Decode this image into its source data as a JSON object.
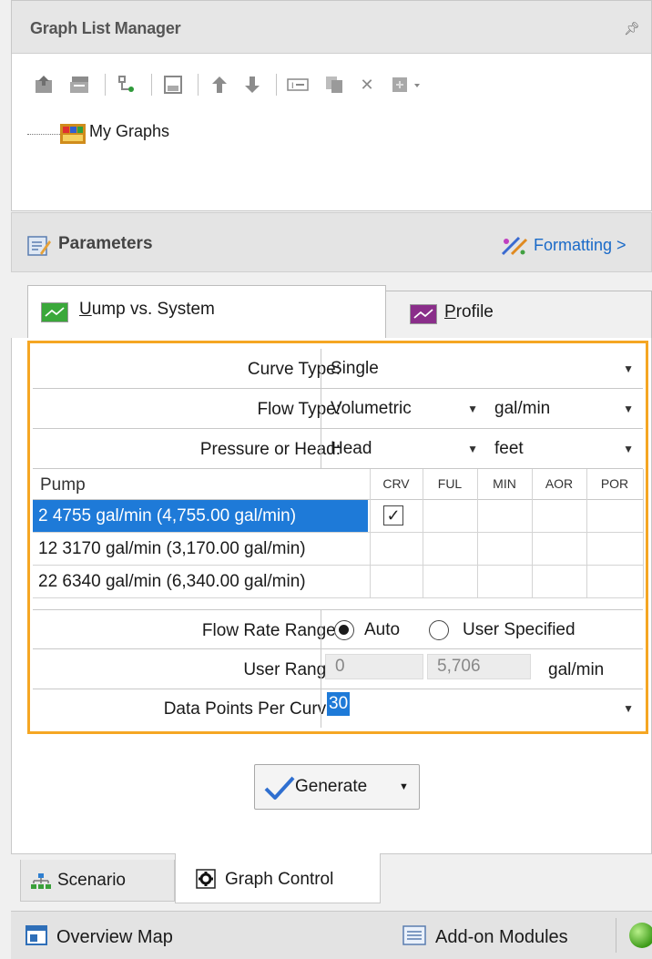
{
  "graph_list_manager": {
    "title": "Graph List Manager",
    "pin_icon": "pin-icon",
    "toolbar_icons": [
      "add-graph-icon",
      "add-folder-icon",
      "graph-options-icon",
      "save-icon",
      "move-up-icon",
      "move-down-icon",
      "rename-icon",
      "copy-icon",
      "delete-icon",
      "refresh-icon"
    ],
    "tree": {
      "root_label": "My Graphs",
      "root_icon": "graph-folder-icon"
    }
  },
  "parameters": {
    "title": "Parameters",
    "formatting_label": "Formatting >"
  },
  "tabs": [
    {
      "label": "Pump vs. System",
      "accent": "U",
      "rest": "ump vs. System",
      "selected": true,
      "icon_color": "#3aa83a"
    },
    {
      "label": "Profile",
      "accent": "P",
      "rest": "rofile",
      "selected": false,
      "icon_color": "#8a2e8a"
    }
  ],
  "form": {
    "curve_type": {
      "label": "Curve Type:",
      "value": "Single"
    },
    "flow_type": {
      "label": "Flow Type:",
      "value": "Volumetric",
      "unit": "gal/min"
    },
    "pressure_or_head": {
      "label": "Pressure or Head:",
      "value": "Head",
      "unit": "feet"
    },
    "pump_table": {
      "columns": [
        "Pump",
        "CRV",
        "FUL",
        "MIN",
        "AOR",
        "POR"
      ],
      "rows": [
        {
          "name": "2  4755 gal/min  (4,755.00 gal/min)",
          "selected": true,
          "crv": true
        },
        {
          "name": "12  3170 gal/min  (3,170.00 gal/min)",
          "selected": false,
          "crv": false
        },
        {
          "name": "22  6340 gal/min  (6,340.00 gal/min)",
          "selected": false,
          "crv": false
        }
      ],
      "checkmark": "✓"
    },
    "flow_rate_range": {
      "label": "Flow Rate Range:",
      "options": [
        "Auto",
        "User Specified"
      ],
      "selected": "Auto"
    },
    "user_range": {
      "label": "User Range:",
      "min": "0",
      "max": "5,706",
      "unit": "gal/min"
    },
    "data_points": {
      "label": "Data Points Per Curve:",
      "value": "30"
    }
  },
  "generate_button": {
    "label": "Generate"
  },
  "bottom_tabs": [
    {
      "label": "Scenario",
      "icon": "scenario-tree-icon",
      "selected": false
    },
    {
      "label": "Graph Control",
      "icon": "gear-icon",
      "selected": true
    }
  ],
  "status_bar": {
    "overview_map": "Overview Map",
    "addon_modules": "Add-on Modules",
    "status_color": "#3c9a18"
  },
  "colors": {
    "highlight": "#f5a623",
    "selection": "#1e7ad8",
    "link": "#1a6ac8"
  }
}
